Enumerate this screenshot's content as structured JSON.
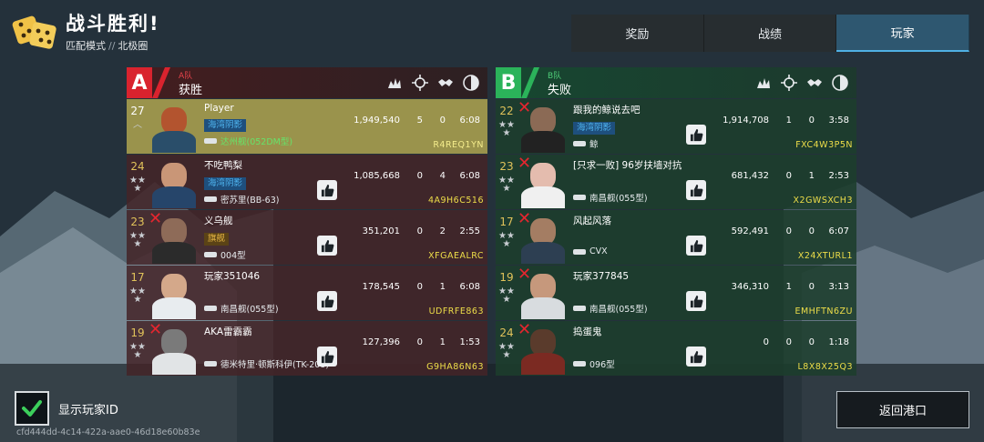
{
  "header": {
    "title": "战斗胜利!",
    "mode": "匹配模式",
    "separator": "//",
    "map": "北极圈"
  },
  "tabs": [
    {
      "label": "奖励",
      "active": false
    },
    {
      "label": "战绩",
      "active": false
    },
    {
      "label": "玩家",
      "active": true
    }
  ],
  "columns": {
    "icons": [
      "damage-icon",
      "kills-icon",
      "assists-icon",
      "time-icon"
    ]
  },
  "team_a": {
    "letter": "A",
    "tag": "A队",
    "result": "获胜",
    "color": "#d9232e",
    "players": [
      {
        "rank": "27",
        "name": "Player",
        "tag": "海湾阴影",
        "tag_style": "blue",
        "ship": "达州舰(052DM型)",
        "score": "1,949,540",
        "kills": "5",
        "assists": "0",
        "time": "6:08",
        "id": "R4REQ1YN",
        "dead": false,
        "self": true,
        "like": false
      },
      {
        "rank": "24",
        "name": "不吃鸭梨",
        "tag": "海湾阴影",
        "tag_style": "blue",
        "ship": "密苏里(BB-63)",
        "score": "1,085,668",
        "kills": "0",
        "assists": "4",
        "time": "6:08",
        "id": "4A9H6C516",
        "dead": false,
        "self": false,
        "like": true
      },
      {
        "rank": "23",
        "name": "义乌舰",
        "tag": "旗舰",
        "tag_style": "gold",
        "ship": "004型",
        "score": "351,201",
        "kills": "0",
        "assists": "2",
        "time": "2:55",
        "id": "XFGAEALRC",
        "dead": true,
        "self": false,
        "like": true
      },
      {
        "rank": "17",
        "name": "玩家351046",
        "tag": "",
        "tag_style": "",
        "ship": "南昌舰(055型)",
        "score": "178,545",
        "kills": "0",
        "assists": "1",
        "time": "6:08",
        "id": "UDFRFE863",
        "dead": false,
        "self": false,
        "like": true
      },
      {
        "rank": "19",
        "name": "AKA雷霸霸",
        "tag": "",
        "tag_style": "",
        "ship": "德米特里·顿斯科伊(TK-208)",
        "score": "127,396",
        "kills": "0",
        "assists": "1",
        "time": "1:53",
        "id": "G9HA86N63",
        "dead": true,
        "self": false,
        "like": true
      }
    ]
  },
  "team_b": {
    "letter": "B",
    "tag": "B队",
    "result": "失败",
    "color": "#2bb35a",
    "players": [
      {
        "rank": "22",
        "name": "跟我的鲸说去吧",
        "tag": "海湾阴影",
        "tag_style": "blue",
        "ship": "鲸",
        "score": "1,914,708",
        "kills": "1",
        "assists": "0",
        "time": "3:58",
        "id": "FXC4W3P5N",
        "dead": true,
        "self": false,
        "like": true
      },
      {
        "rank": "23",
        "name": "[只求一败] 96岁扶墙对抗",
        "tag": "",
        "tag_style": "",
        "ship": "南昌舰(055型)",
        "score": "681,432",
        "kills": "0",
        "assists": "1",
        "time": "2:53",
        "id": "X2GWSXCH3",
        "dead": true,
        "self": false,
        "like": true
      },
      {
        "rank": "17",
        "name": "风起风落",
        "tag": "",
        "tag_style": "",
        "ship": "CVX",
        "score": "592,491",
        "kills": "0",
        "assists": "0",
        "time": "6:07",
        "id": "X24XTURL1",
        "dead": true,
        "self": false,
        "like": true
      },
      {
        "rank": "19",
        "name": "玩家377845",
        "tag": "",
        "tag_style": "",
        "ship": "南昌舰(055型)",
        "score": "346,310",
        "kills": "1",
        "assists": "0",
        "time": "3:13",
        "id": "EMHFTN6ZU",
        "dead": true,
        "self": false,
        "like": true
      },
      {
        "rank": "24",
        "name": "捣蛋鬼",
        "tag": "",
        "tag_style": "",
        "ship": "096型",
        "score": "0",
        "kills": "0",
        "assists": "0",
        "time": "1:18",
        "id": "L8X8X25Q3",
        "dead": true,
        "self": false,
        "like": true
      }
    ]
  },
  "footer": {
    "show_id_label": "显示玩家ID",
    "show_id_checked": true,
    "match_id": "cfd444dd-4c14-422a-aae0-46d18e60b83e",
    "return_label": "返回港口"
  }
}
